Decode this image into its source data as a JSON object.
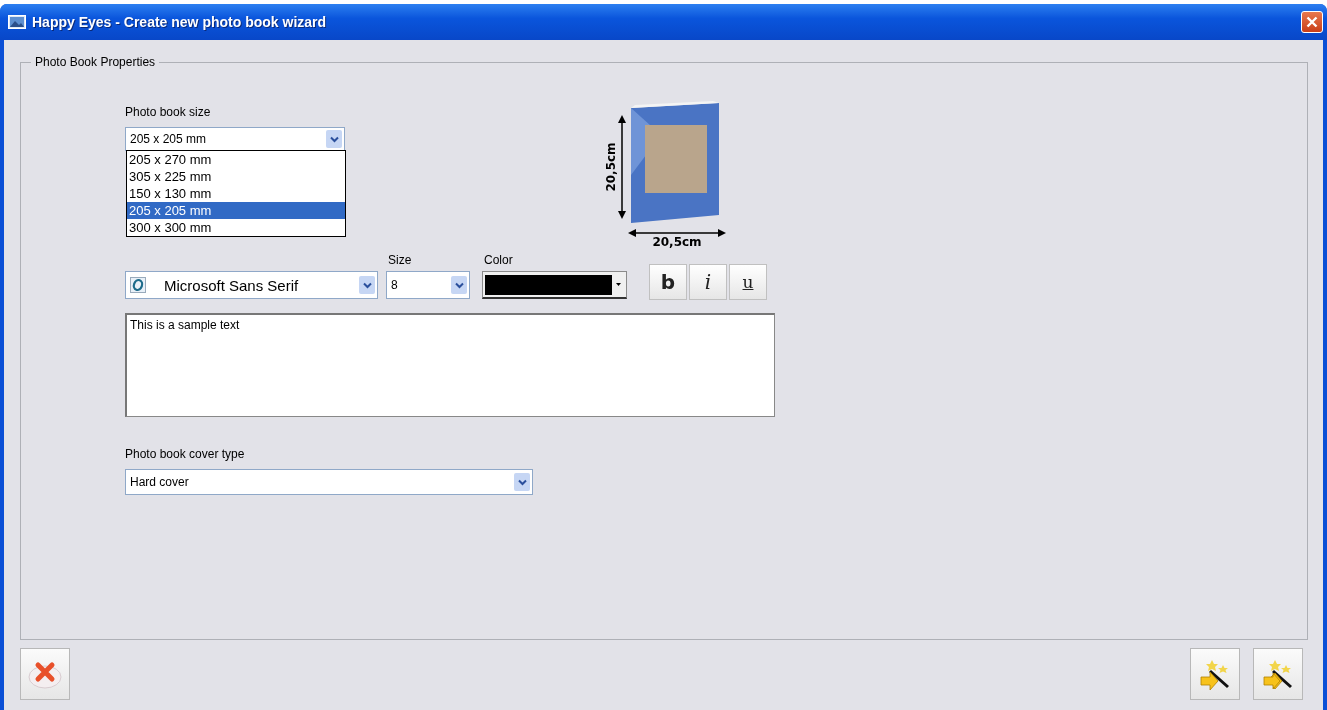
{
  "window": {
    "title": "Happy Eyes - Create new photo book wizard"
  },
  "group": {
    "title": "Photo Book Properties"
  },
  "size_field": {
    "label": "Photo book size",
    "value": "205 x 205 mm",
    "expanded": true,
    "options": [
      {
        "label": "205 x 270 mm",
        "selected": false
      },
      {
        "label": "305 x 225 mm",
        "selected": false
      },
      {
        "label": "150 x 130 mm",
        "selected": false
      },
      {
        "label": "205 x 205 mm",
        "selected": true
      },
      {
        "label": "300 x 300 mm",
        "selected": false
      }
    ]
  },
  "preview": {
    "height_label": "20,5cm",
    "width_label": "20,5cm"
  },
  "text_style": {
    "font": "Microsoft Sans Serif",
    "size_label": "Size",
    "size": "8",
    "color_label": "Color",
    "color": "#000000",
    "buttons": [
      "b",
      "i",
      "u"
    ]
  },
  "sample_text": {
    "value": "This is a sample text"
  },
  "cover_field": {
    "label": "Photo book cover type",
    "value": "Hard cover"
  }
}
